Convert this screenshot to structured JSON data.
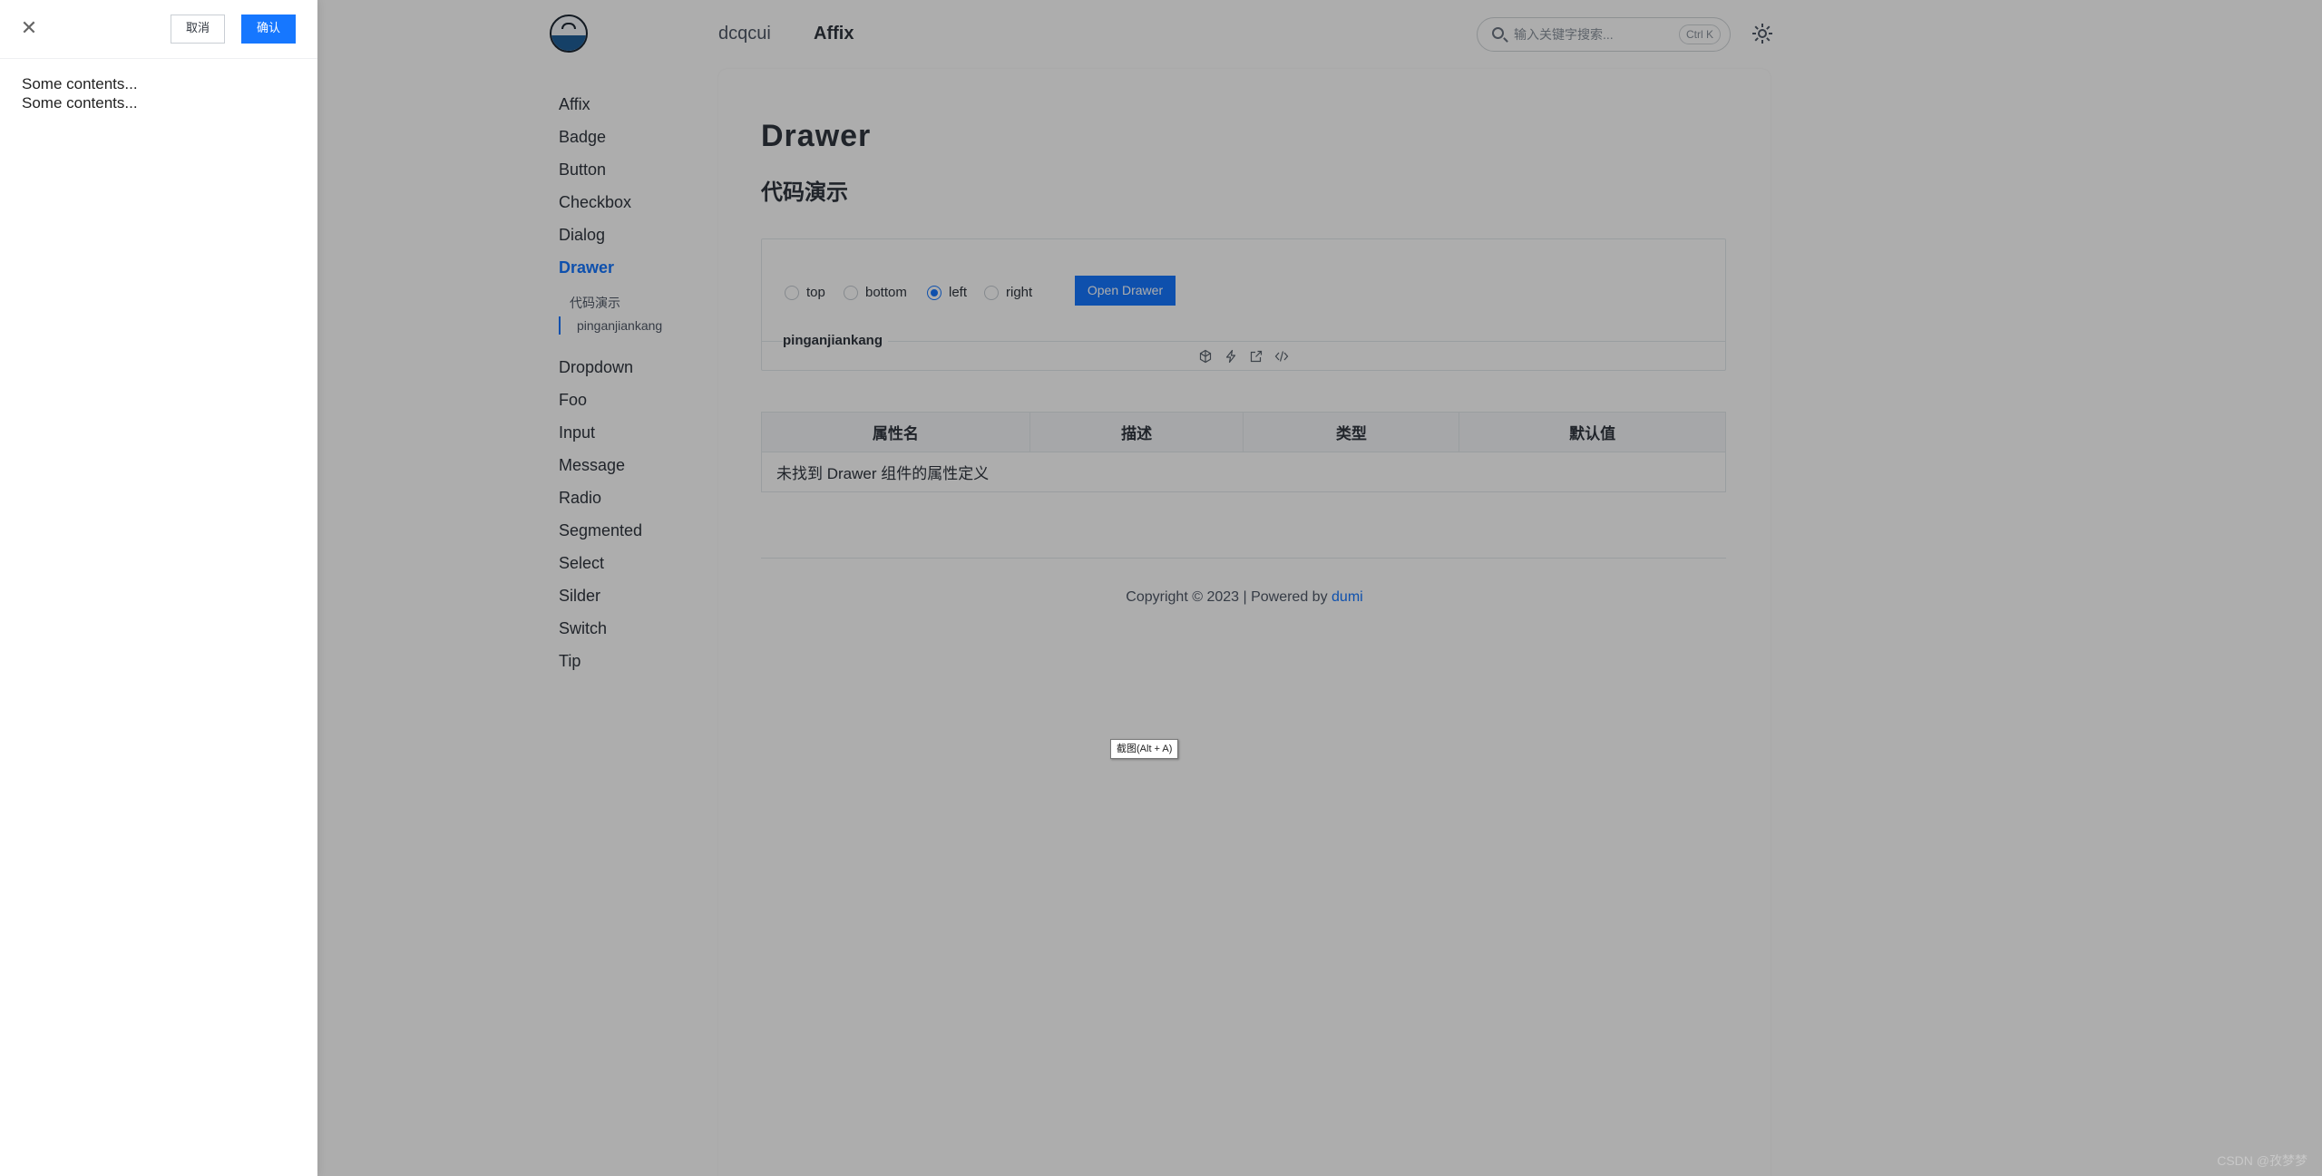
{
  "header": {
    "nav": [
      "dcqcui",
      "Affix"
    ],
    "search": {
      "placeholder": "输入关键字搜索...",
      "shortcut": "Ctrl K"
    }
  },
  "sidebar": {
    "items": [
      "Affix",
      "Badge",
      "Button",
      "Checkbox",
      "Dialog",
      "Drawer",
      "Dropdown",
      "Foo",
      "Input",
      "Message",
      "Radio",
      "Segmented",
      "Select",
      "Silder",
      "Switch",
      "Tip"
    ],
    "active": "Drawer",
    "sub_items": [
      "代码演示",
      "pinganjiankang"
    ]
  },
  "content": {
    "title": "Drawer",
    "section": "代码演示",
    "demo": {
      "placements": [
        "top",
        "bottom",
        "left",
        "right"
      ],
      "selected": "left",
      "open_button": "Open Drawer",
      "name": "pinganjiankang",
      "actions": [
        "codesandbox-icon",
        "stackblitz-icon",
        "open-external-icon",
        "code-icon"
      ]
    },
    "api_table": {
      "headers": [
        "属性名",
        "描述",
        "类型",
        "默认值"
      ],
      "empty_text": "未找到 Drawer 组件的属性定义"
    },
    "footer": {
      "prefix": "Copyright © 2023 | Powered by ",
      "link": "dumi"
    }
  },
  "drawer": {
    "cancel": "取消",
    "confirm": "确认",
    "lines": [
      "Some contents...",
      "Some contents..."
    ]
  },
  "tooltip": "截图(Alt + A)",
  "watermark": "CSDN @孜梦梦",
  "colors": {
    "primary": "#1677ff",
    "mask": "rgba(0,0,0,0.32)"
  }
}
